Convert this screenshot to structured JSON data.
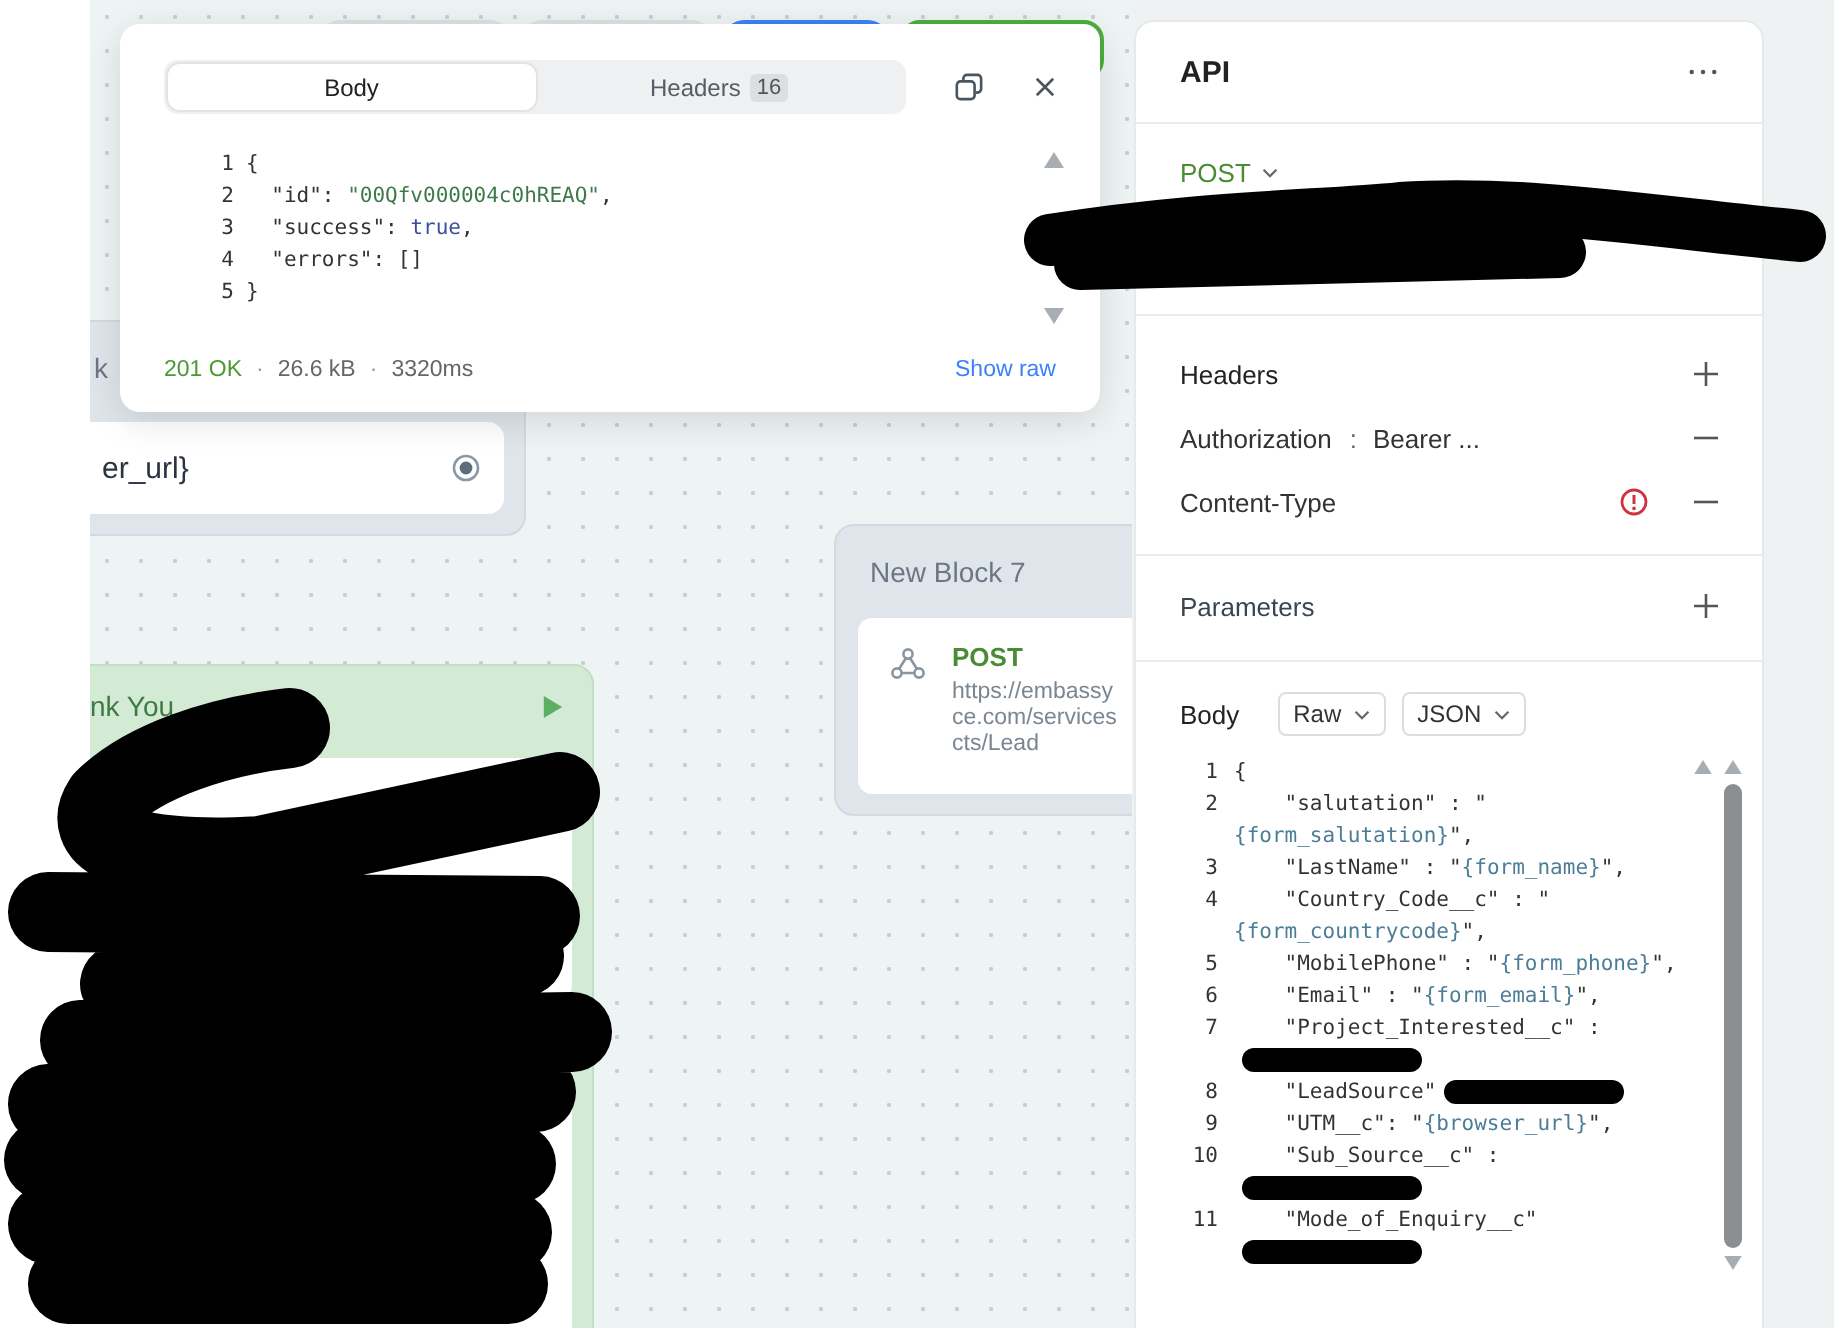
{
  "canvas": {
    "toolbar_buttons": [
      {
        "kind": "secondary"
      },
      {
        "kind": "secondary"
      },
      {
        "kind": "primary"
      },
      {
        "kind": "success"
      }
    ],
    "block_6": {
      "title": "k",
      "field": "er_url}"
    },
    "thank_you_block": {
      "title": "nk You"
    },
    "block_7": {
      "title": "New Block 7",
      "method": "POST",
      "url_lines": [
        "https://embassy",
        "ce.com/services",
        "cts/Lead"
      ]
    }
  },
  "response_popup": {
    "tabs": [
      {
        "label": "Body",
        "selected": true
      },
      {
        "label": "Headers",
        "badge": "16",
        "selected": false
      }
    ],
    "lines": [
      {
        "number": "1",
        "tokens": [
          {
            "t": "{"
          }
        ]
      },
      {
        "number": "2",
        "tokens": [
          {
            "t": "  \"id\": "
          },
          {
            "t": "\"00Qfv000004c0hREAQ\"",
            "kind": "string"
          },
          {
            "t": ","
          }
        ]
      },
      {
        "number": "3",
        "tokens": [
          {
            "t": "  \"success\": "
          },
          {
            "t": "true",
            "kind": "bool"
          },
          {
            "t": ","
          }
        ]
      },
      {
        "number": "4",
        "tokens": [
          {
            "t": "  \"errors\": []"
          }
        ]
      },
      {
        "number": "5",
        "tokens": [
          {
            "t": "}"
          }
        ]
      }
    ],
    "status": [
      {
        "text": "201 OK",
        "kind": "status"
      },
      {
        "text": "·",
        "kind": "sep"
      },
      {
        "text": "26.6 kB",
        "kind": "meta"
      },
      {
        "text": "·",
        "kind": "sep"
      },
      {
        "text": "3320ms",
        "kind": "meta"
      }
    ],
    "show_raw": "Show raw"
  },
  "api_panel": {
    "title": "API",
    "method": "POST",
    "headers_title": "Headers",
    "headers": [
      {
        "name": "Authorization",
        "separator": ":",
        "value": "Bearer ...",
        "warning": false
      },
      {
        "name": "Content-Type",
        "warning": true
      }
    ],
    "parameters_title": "Parameters",
    "body": {
      "label": "Body",
      "dropdowns": [
        "Raw",
        "JSON"
      ],
      "lines": [
        {
          "number": "1",
          "tokens": [
            {
              "t": "{"
            }
          ],
          "redacted": false
        },
        {
          "number": "2",
          "tokens": [
            {
              "t": "    \"salutation\" : \""
            },
            {
              "t": "{form_salutation}",
              "kind": "var"
            },
            {
              "t": "\","
            }
          ],
          "redacted": false
        },
        {
          "number": "3",
          "tokens": [
            {
              "t": "    \"LastName\" : \""
            },
            {
              "t": "{form_name}",
              "kind": "var"
            },
            {
              "t": "\","
            }
          ],
          "redacted": false
        },
        {
          "number": "4",
          "tokens": [
            {
              "t": "    \"Country_Code__c\" : \""
            },
            {
              "t": "{form_countrycode}",
              "kind": "var"
            },
            {
              "t": "\","
            }
          ],
          "redacted": false
        },
        {
          "number": "5",
          "tokens": [
            {
              "t": "    \"MobilePhone\" : \""
            },
            {
              "t": "{form_phone}",
              "kind": "var"
            },
            {
              "t": "\","
            }
          ],
          "redacted": false
        },
        {
          "number": "6",
          "tokens": [
            {
              "t": "    \"Email\" : \""
            },
            {
              "t": "{form_email}",
              "kind": "var"
            },
            {
              "t": "\","
            }
          ],
          "redacted": false
        },
        {
          "number": "7",
          "tokens": [
            {
              "t": "    \"Project_Interested__c\" :"
            }
          ],
          "redacted": true
        },
        {
          "number": "8",
          "tokens": [
            {
              "t": "    \"LeadSource\""
            }
          ],
          "redacted": true
        },
        {
          "number": "9",
          "tokens": [
            {
              "t": "    \"UTM__c\": \""
            },
            {
              "t": "{browser_url}",
              "kind": "var"
            },
            {
              "t": "\","
            }
          ],
          "redacted": false
        },
        {
          "number": "10",
          "tokens": [
            {
              "t": "    \"Sub_Source__c\" :"
            }
          ],
          "redacted": true
        },
        {
          "number": "11",
          "tokens": [
            {
              "t": "    \"Mode_of_Enquiry__c\""
            }
          ],
          "redacted": true
        }
      ]
    }
  }
}
